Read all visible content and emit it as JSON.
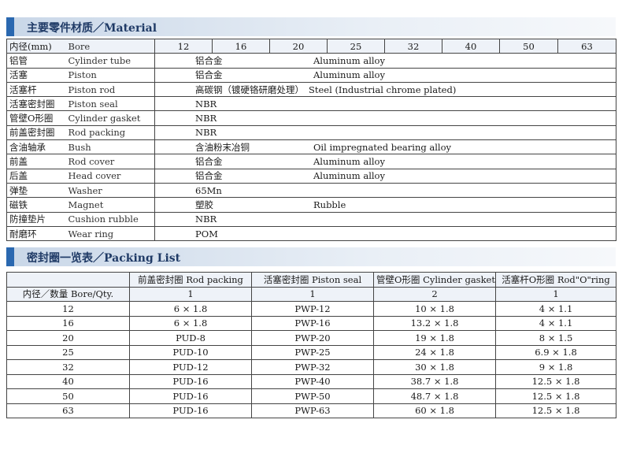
{
  "material": {
    "title": "主要零件材质／Material",
    "bore": {
      "zh": "内径(mm)",
      "en": "Bore",
      "sizes": [
        "12",
        "16",
        "20",
        "25",
        "32",
        "40",
        "50",
        "63"
      ]
    },
    "rows": [
      {
        "zh": "铝管",
        "en": "Cylinder tube",
        "mat_zh": "铝合金",
        "mat_en": "Aluminum alloy"
      },
      {
        "zh": "活塞",
        "en": "Piston",
        "mat_zh": "铝合金",
        "mat_en": "Aluminum alloy"
      },
      {
        "zh": "活塞杆",
        "en": "Piston rod",
        "mat_zh": "高碳钢（镀硬铬研磨处理）",
        "mat_en": "Steel (Industrial chrome plated)"
      },
      {
        "zh": "活塞密封圈",
        "en": "Piston seal",
        "mat_zh": "NBR",
        "mat_en": ""
      },
      {
        "zh": "管壁O形圈",
        "en": "Cylinder gasket",
        "mat_zh": "NBR",
        "mat_en": ""
      },
      {
        "zh": "前盖密封圈",
        "en": "Rod packing",
        "mat_zh": "NBR",
        "mat_en": ""
      },
      {
        "zh": "含油轴承",
        "en": "Bush",
        "mat_zh": "含油粉末冶铜",
        "mat_en": "Oil impregnated bearing alloy"
      },
      {
        "zh": "前盖",
        "en": "Rod cover",
        "mat_zh": "铝合金",
        "mat_en": "Aluminum alloy"
      },
      {
        "zh": "后盖",
        "en": "Head cover",
        "mat_zh": "铝合金",
        "mat_en": "Aluminum alloy"
      },
      {
        "zh": "弹垫",
        "en": "Washer",
        "mat_zh": "65Mn",
        "mat_en": ""
      },
      {
        "zh": "磁铁",
        "en": "Magnet",
        "mat_zh": "塑胶",
        "mat_en": "Rubble"
      },
      {
        "zh": "防撞垫片",
        "en": "Cushion rubble",
        "mat_zh": "NBR",
        "mat_en": ""
      },
      {
        "zh": "耐磨环",
        "en": "Wear ring",
        "mat_zh": "POM",
        "mat_en": ""
      }
    ]
  },
  "packing": {
    "title": "密封圈一览表／Packing  List",
    "headers": [
      "",
      "前盖密封圈 Rod packing",
      "活塞密封圈 Piston seal",
      "管壁O形圈 Cylinder gasket",
      "活塞杆O形圈 Rod\"O\"ring"
    ],
    "qty_label": "内径／数量 Bore/Qty.",
    "qty": [
      "1",
      "1",
      "2",
      "1"
    ],
    "rows": [
      [
        "12",
        "6 × 1.8",
        "PWP-12",
        "10 × 1.8",
        "4 × 1.1"
      ],
      [
        "16",
        "6 × 1.8",
        "PWP-16",
        "13.2 × 1.8",
        "4 × 1.1"
      ],
      [
        "20",
        "PUD-8",
        "PWP-20",
        "19 × 1.8",
        "8 × 1.5"
      ],
      [
        "25",
        "PUD-10",
        "PWP-25",
        "24 × 1.8",
        "6.9 × 1.8"
      ],
      [
        "32",
        "PUD-12",
        "PWP-32",
        "30 × 1.8",
        "9 × 1.8"
      ],
      [
        "40",
        "PUD-16",
        "PWP-40",
        "38.7 × 1.8",
        "12.5 × 1.8"
      ],
      [
        "50",
        "PUD-16",
        "PWP-50",
        "48.7 × 1.8",
        "12.5 × 1.8"
      ],
      [
        "63",
        "PUD-16",
        "PWP-63",
        "60 × 1.8",
        "12.5 × 1.8"
      ]
    ]
  }
}
